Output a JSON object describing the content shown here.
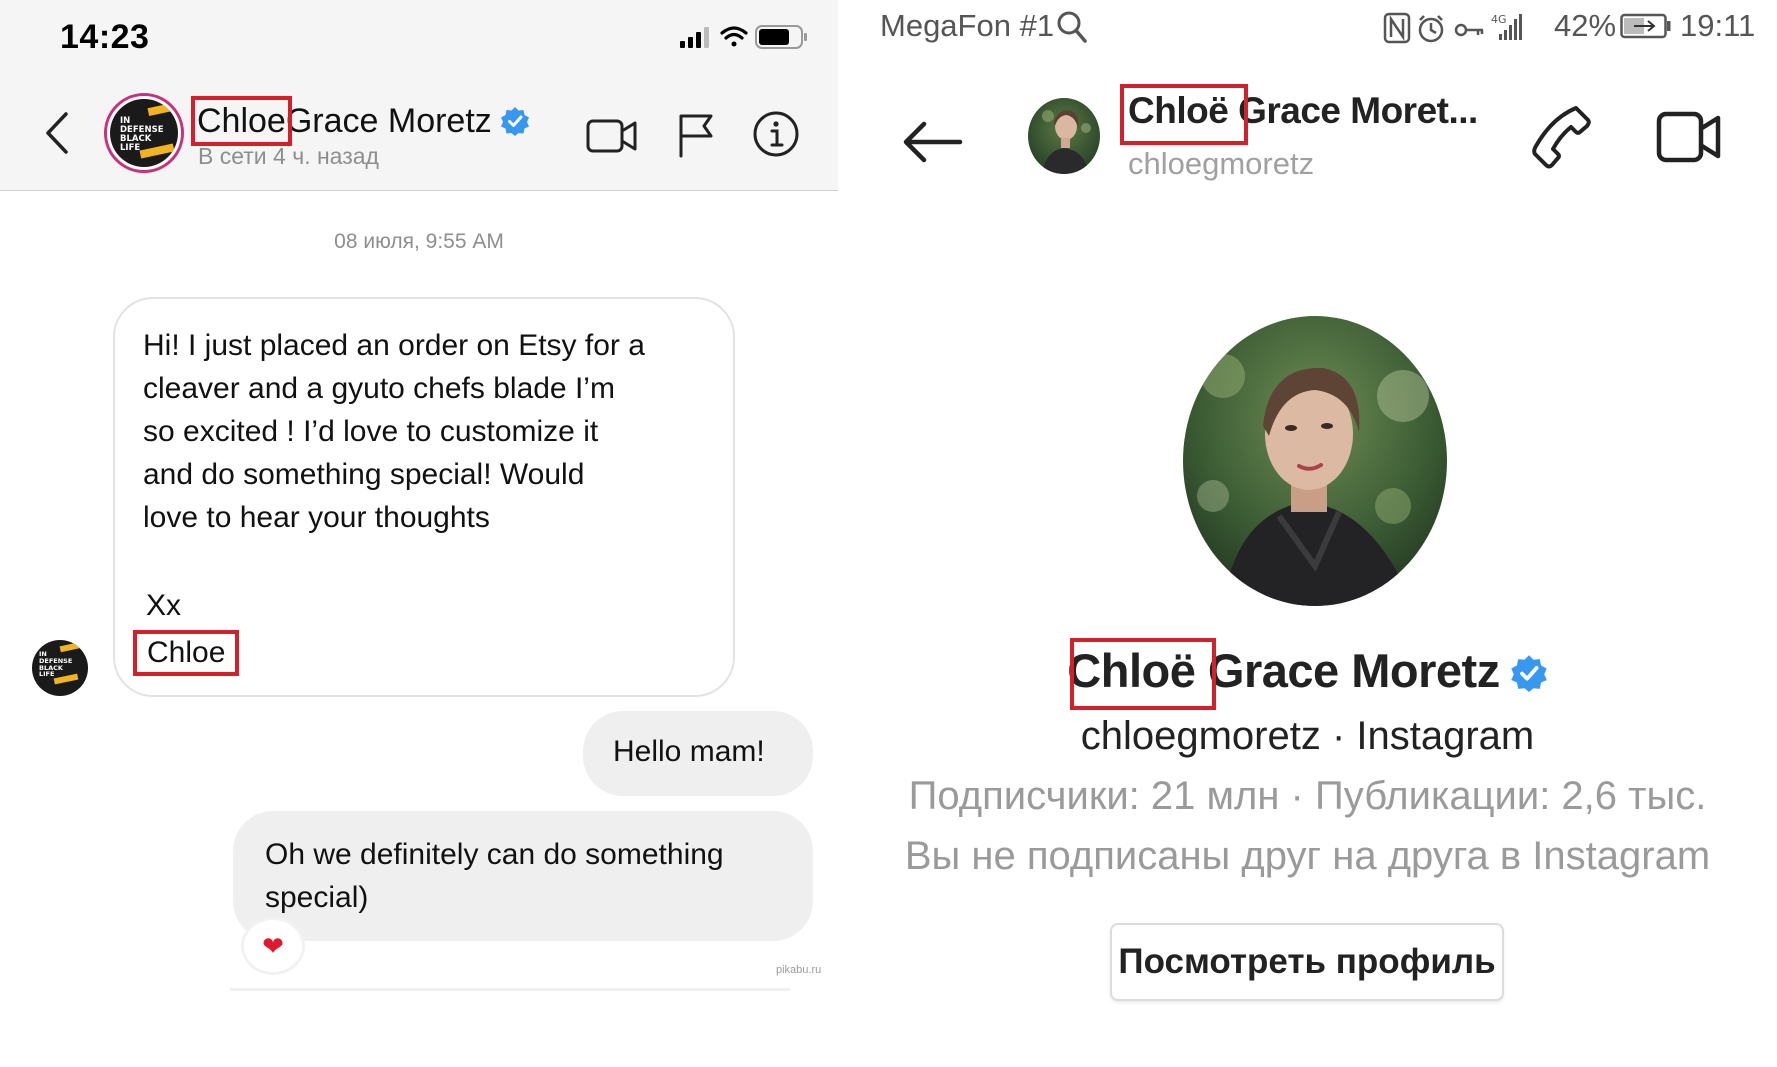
{
  "left_panel": {
    "status_bar": {
      "time": "14:23"
    },
    "header": {
      "name": "Chloe Grace Moretz",
      "name_highlight": "Chloe",
      "name_rest": "Grace Moretz",
      "subtitle": "В сети 4 ч. назад"
    },
    "conversation": {
      "date": "08 июля, 9:55 AM",
      "incoming_message": {
        "body": "Hi! I just placed an order on Etsy for a\ncleaver and a gyuto chefs blade I’m\nso excited ! I’d love to customize it\nand do something special! Would\nlove to hear your thoughts",
        "signoff": "Xx",
        "signature": "Chloe"
      },
      "outgoing_messages": [
        {
          "text": "Hello mam!"
        },
        {
          "text": "Oh we definitely can do something\nspecial)"
        }
      ],
      "reaction": "❤"
    },
    "watermark": "pikabu.ru",
    "avatar_logo_text": "IN\nDEFENSE\nBLACK\nLIFE"
  },
  "right_panel": {
    "status_bar": {
      "carrier": "MegaFon #1",
      "battery": "42%",
      "time": "19:11"
    },
    "header": {
      "name_highlight": "Chloë",
      "name_rest": "Grace Moret...",
      "handle": "chloegmoretz"
    },
    "profile": {
      "name_highlight": "Chloë",
      "name_rest": "Grace Moretz",
      "handle_line": "chloegmoretz · Instagram",
      "stats": "Подписчики: 21 млн · Публикации: 2,6 тыс.",
      "follow_status": "Вы не подписаны друг на друга в Instagram",
      "view_profile_label": "Посмотреть профиль"
    }
  },
  "colors": {
    "highlight_box": "#d3202b",
    "verified_blue": "#3897f0",
    "bubble_gray": "#efefef",
    "secondary_text": "#8e8e8e"
  }
}
